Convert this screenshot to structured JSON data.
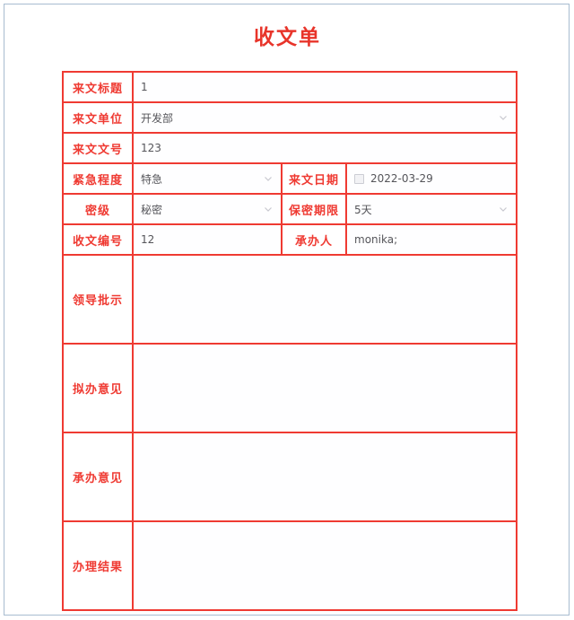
{
  "page": {
    "title": "收文单"
  },
  "form": {
    "rows": [
      {
        "label": "来文标题",
        "type": "text",
        "value": "1"
      },
      {
        "label": "来文单位",
        "type": "select",
        "value": "开发部",
        "chevron": "chevron-down-icon"
      },
      {
        "label": "来文文号",
        "type": "text",
        "value": "123"
      }
    ],
    "paired_rows": [
      {
        "left_label": "紧急程度",
        "left_type": "select",
        "left_value": "特急",
        "right_label": "来文日期",
        "right_type": "date",
        "right_value": "2022-03-29"
      },
      {
        "left_label": "密级",
        "left_type": "select",
        "left_value": "秘密",
        "right_label": "保密期限",
        "right_type": "select",
        "right_value": "5天"
      },
      {
        "left_label": "收文编号",
        "left_type": "text",
        "left_value": "12",
        "right_label": "承办人",
        "right_type": "text",
        "right_value": "monika;"
      }
    ],
    "memo_rows": [
      {
        "label": "领导批示",
        "value": ""
      },
      {
        "label": "拟办意见",
        "value": ""
      },
      {
        "label": "承办意见",
        "value": ""
      },
      {
        "label": "办理结果",
        "value": ""
      }
    ]
  },
  "colors": {
    "accent_red": "#ef3a32",
    "title_red": "#e8342a",
    "page_border": "#a8bcd0",
    "field_text": "#55555a",
    "chevron": "#c8c8cf"
  }
}
